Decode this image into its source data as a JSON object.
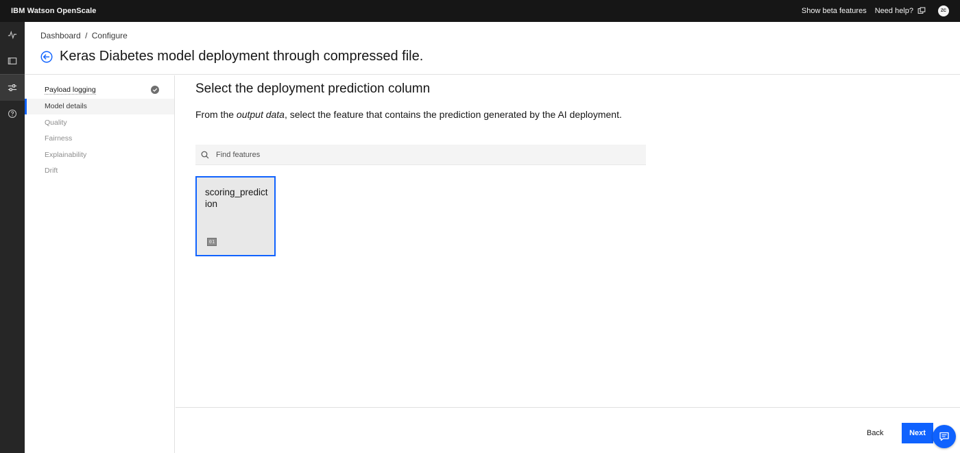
{
  "app": {
    "title": "IBM Watson OpenScale"
  },
  "topbar": {
    "beta_label": "Show beta features",
    "help_label": "Need help?",
    "avatar_initials": "ZC"
  },
  "rail": {
    "items": [
      {
        "icon": "activity-icon"
      },
      {
        "icon": "terminal-icon"
      },
      {
        "icon": "settings-adjust-icon",
        "active": true
      },
      {
        "icon": "help-icon"
      }
    ]
  },
  "breadcrumb": {
    "parent": "Dashboard",
    "separator": "/",
    "current": "Configure"
  },
  "page": {
    "title": "Keras Diabetes model deployment through compressed file."
  },
  "steps": [
    {
      "label": "Payload logging",
      "status": "done"
    },
    {
      "label": "Model details",
      "status": "current"
    },
    {
      "label": "Quality",
      "status": "pending"
    },
    {
      "label": "Fairness",
      "status": "pending"
    },
    {
      "label": "Explainability",
      "status": "pending"
    },
    {
      "label": "Drift",
      "status": "pending"
    }
  ],
  "main": {
    "section_title": "Select the deployment prediction column",
    "description_prefix": "From the ",
    "description_emphasis": "output data",
    "description_suffix": ", select the feature that contains the prediction generated by the AI deployment.",
    "search_placeholder": "Find features",
    "features": [
      {
        "name": "scoring_prediction",
        "type_glyph": "01",
        "selected": true
      }
    ]
  },
  "footer": {
    "back_label": "Back",
    "next_label": "Next"
  },
  "colors": {
    "primary": "#0f62fe",
    "header_bg": "#161616",
    "rail_bg": "#262626"
  }
}
